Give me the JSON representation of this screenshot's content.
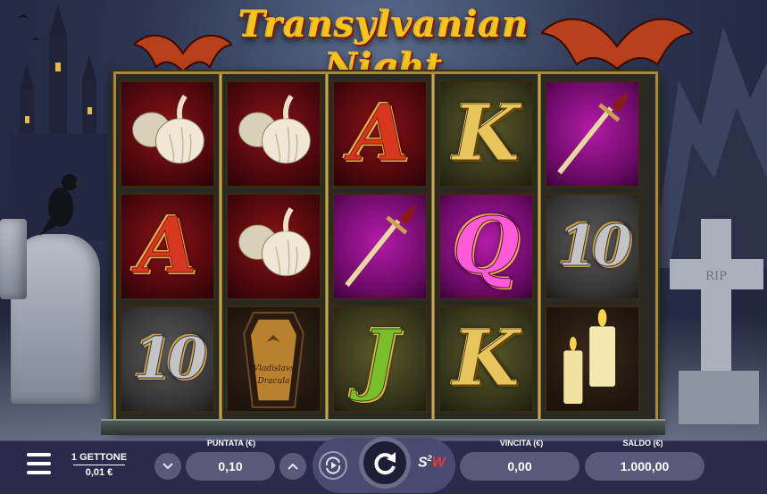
{
  "game": {
    "title": "Transylvanian Night"
  },
  "reels": [
    [
      {
        "symbol": "garlic-icon"
      },
      {
        "symbol": "letter-a",
        "text": "A"
      },
      {
        "symbol": "ten",
        "text": "10"
      }
    ],
    [
      {
        "symbol": "garlic-icon"
      },
      {
        "symbol": "garlic-icon"
      },
      {
        "symbol": "coffin-icon",
        "line1": "Vladislavs",
        "line2": "Dracula"
      }
    ],
    [
      {
        "symbol": "letter-a",
        "text": "A"
      },
      {
        "symbol": "dagger-icon"
      },
      {
        "symbol": "letter-j",
        "text": "J"
      }
    ],
    [
      {
        "symbol": "letter-k",
        "text": "K"
      },
      {
        "symbol": "letter-q",
        "text": "Q"
      },
      {
        "symbol": "letter-k",
        "text": "K"
      }
    ],
    [
      {
        "symbol": "dagger-icon"
      },
      {
        "symbol": "ten",
        "text": "10"
      },
      {
        "symbol": "candles-icon"
      }
    ]
  ],
  "tombstone_text": "RIP",
  "bottom_bar": {
    "menu_icon": "hamburger-menu-icon",
    "token_label": "1 GETTONE",
    "token_value": "0,01 €",
    "bet_label": "PUNTATA (€)",
    "bet_value": "0,10",
    "bet_decrease_icon": "chevron-down-icon",
    "bet_increase_icon": "chevron-up-icon",
    "autoplay_icon": "autoplay-icon",
    "spin_icon": "spin-icon",
    "s2w_s": "S",
    "s2w_2": "2",
    "s2w_w": "W",
    "win_label": "VINCITA (€)",
    "win_value": "0,00",
    "balance_label": "SALDO (€)",
    "balance_value": "1.000,00"
  },
  "colors": {
    "bar_bg": "#2b2a4d",
    "pill_bg": "#5a597c",
    "title_gold": "#f5c518",
    "frame_gold": "#a88a3a"
  }
}
